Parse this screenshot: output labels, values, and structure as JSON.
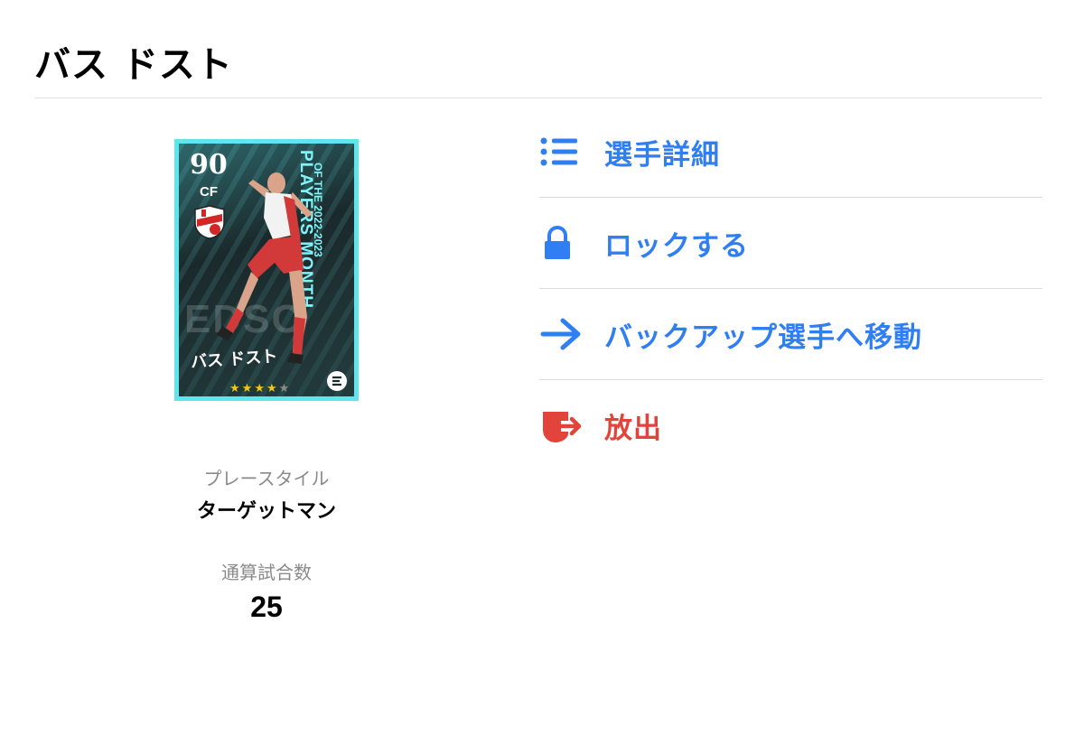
{
  "page": {
    "title": "バス ドスト"
  },
  "card": {
    "rating": "90",
    "position": "CF",
    "player_name": "バス ドスト",
    "side_text": "PLAYERS MONTH",
    "side_subtext": "OF THE  2022-2023",
    "background_text": "EDSO",
    "stars_filled": 4,
    "stars_total": 5,
    "border_color": "#5ee6ec"
  },
  "stats": {
    "playstyle_label": "プレースタイル",
    "playstyle_value": "ターゲットマン",
    "matches_label": "通算試合数",
    "matches_value": "25"
  },
  "menu": {
    "items": [
      {
        "label": "選手詳細",
        "icon": "list-icon",
        "color": "#2f7ef2"
      },
      {
        "label": "ロックする",
        "icon": "lock-icon",
        "color": "#2f7ef2"
      },
      {
        "label": "バックアップ選手へ移動",
        "icon": "arrow-right-icon",
        "color": "#2f7ef2"
      },
      {
        "label": "放出",
        "icon": "release-icon",
        "color": "#e2433a"
      }
    ]
  }
}
